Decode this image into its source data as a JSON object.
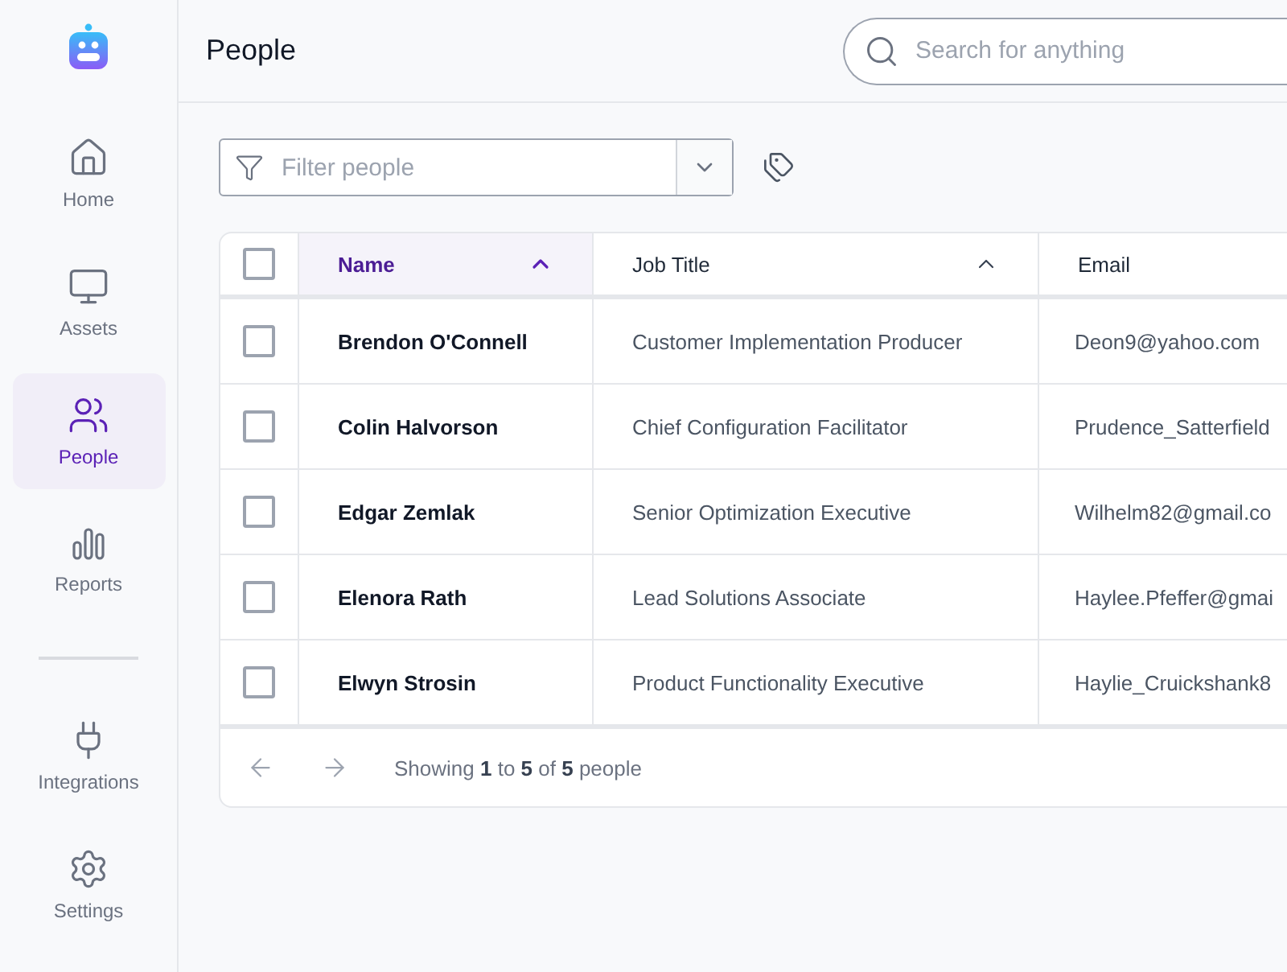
{
  "sidebar": {
    "items": [
      {
        "label": "Home",
        "selected": false
      },
      {
        "label": "Assets",
        "selected": false
      },
      {
        "label": "People",
        "selected": true
      },
      {
        "label": "Reports",
        "selected": false
      }
    ],
    "bottom_items": [
      {
        "label": "Integrations",
        "selected": false
      },
      {
        "label": "Settings",
        "selected": false
      }
    ]
  },
  "header": {
    "title": "People",
    "search": {
      "placeholder": "Search for anything"
    }
  },
  "filter": {
    "placeholder": "Filter people"
  },
  "table": {
    "select_all": {
      "checked": false
    },
    "columns": [
      {
        "label": "Name",
        "sorted": true,
        "caret": true
      },
      {
        "label": "Job Title",
        "sorted": false,
        "caret": true
      },
      {
        "label": "Email",
        "sorted": false,
        "caret": false
      }
    ],
    "rows": [
      {
        "checked": false,
        "cells": [
          "Brendon O'Connell",
          "Customer Implementation Producer",
          "Deon9@yahoo.com"
        ]
      },
      {
        "checked": false,
        "cells": [
          "Colin Halvorson",
          "Chief Configuration Facilitator",
          "Prudence_Satterfield"
        ]
      },
      {
        "checked": false,
        "cells": [
          "Edgar Zemlak",
          "Senior Optimization Executive",
          "Wilhelm82@gmail.co"
        ]
      },
      {
        "checked": false,
        "cells": [
          "Elenora Rath",
          "Lead Solutions Associate",
          "Haylee.Pfeffer@gmai"
        ]
      },
      {
        "checked": false,
        "cells": [
          "Elwyn Strosin",
          "Product Functionality Executive",
          "Haylie_Cruickshank8"
        ]
      }
    ],
    "footer": "Showing **1** to **5** of **5** people"
  }
}
